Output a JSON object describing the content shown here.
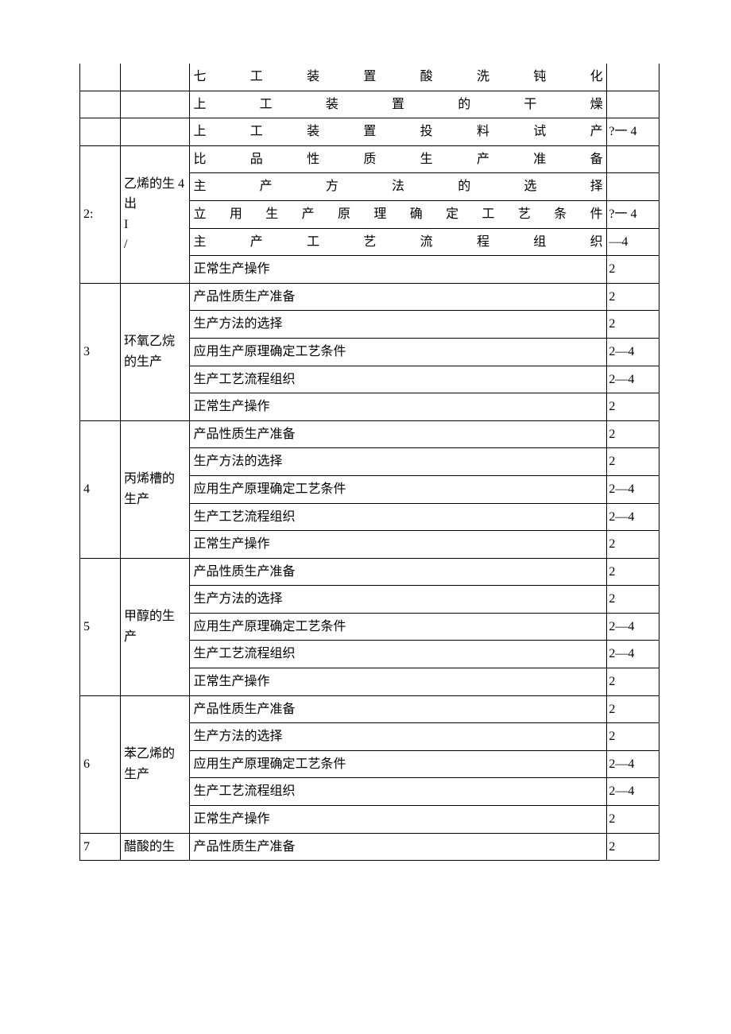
{
  "rows": [
    {
      "num": "",
      "name": "",
      "content": "七工装置酸洗钝化",
      "hours": "",
      "justify": true,
      "cellFlags": {
        "numNoTop": true,
        "nameNoTop": true,
        "contNoTop": true,
        "hoursNoTop": true
      },
      "spanNum": 1,
      "spanName": 1
    },
    {
      "num": "",
      "name": "",
      "content": "上工装置的干燥",
      "hours": "",
      "justify": true,
      "cellFlags": {
        "numNoTop": true,
        "nameNoTop": true
      },
      "spanNum": 1,
      "spanName": 1
    },
    {
      "num": "",
      "name": "",
      "content": "上工装置投料试产",
      "hours": "?一 4",
      "justify": true,
      "cellFlags": {
        "numNoTop": true,
        "nameNoTop": true
      },
      "spanNum": 1,
      "spanName": 1
    },
    {
      "num": "2:",
      "name": "乙烯的生 4\n出\nI\n/",
      "content": "比品性质生产准备",
      "hours": "",
      "justify": true,
      "spanNum": 5,
      "spanName": 5
    },
    {
      "content": "主产方法的选择",
      "hours": "",
      "justify": true
    },
    {
      "content": "立用生产原理确定工艺条件",
      "hours": "?一 4",
      "justify": true
    },
    {
      "content": "主产工艺流程组织",
      "hours": "—4",
      "justify": true
    },
    {
      "content": "正常生产操作",
      "hours": "2",
      "justify": false
    },
    {
      "num": "3",
      "name": "环氧乙烷的生产",
      "content": "产品性质生产准备",
      "hours": "2",
      "justify": false,
      "spanNum": 5,
      "spanName": 5
    },
    {
      "content": "生产方法的选择",
      "hours": "2",
      "justify": false
    },
    {
      "content": "应用生产原理确定工艺条件",
      "hours": "2—4",
      "justify": false
    },
    {
      "content": "生产工艺流程组织",
      "hours": "2—4",
      "justify": false
    },
    {
      "content": "正常生产操作",
      "hours": "2",
      "justify": false
    },
    {
      "num": "4",
      "name": "丙烯槽的生产",
      "content": "产品性质生产准备",
      "hours": "2",
      "justify": false,
      "spanNum": 5,
      "spanName": 5
    },
    {
      "content": "生产方法的选择",
      "hours": "2",
      "justify": false
    },
    {
      "content": "应用生产原理确定工艺条件",
      "hours": "2—4",
      "justify": false
    },
    {
      "content": "生产工艺流程组织",
      "hours": "2—4",
      "justify": false
    },
    {
      "content": "正常生产操作",
      "hours": "2",
      "justify": false
    },
    {
      "num": "5",
      "name": "甲醇的生产",
      "content": "产品性质生产准备",
      "hours": "2",
      "justify": false,
      "spanNum": 5,
      "spanName": 5
    },
    {
      "content": "生产方法的选择",
      "hours": "2",
      "justify": false
    },
    {
      "content": "应用生产原理确定工艺条件",
      "hours": "2—4",
      "justify": false
    },
    {
      "content": "生产工艺流程组织",
      "hours": "2—4",
      "justify": false
    },
    {
      "content": "正常生产操作",
      "hours": "2",
      "justify": false
    },
    {
      "num": "6",
      "name": "苯乙烯的生产",
      "content": "产品性质生产准备",
      "hours": "2",
      "justify": false,
      "spanNum": 5,
      "spanName": 5
    },
    {
      "content": "生产方法的选择",
      "hours": "2",
      "justify": false
    },
    {
      "content": "应用生产原理确定工艺条件",
      "hours": "2—4",
      "justify": false
    },
    {
      "content": "生产工艺流程组织",
      "hours": "2—4",
      "justify": false
    },
    {
      "content": "正常生产操作",
      "hours": "2",
      "justify": false
    },
    {
      "num": "7",
      "name": "醋酸的生",
      "content": "产品性质生产准备",
      "hours": "2",
      "justify": false,
      "spanNum": 1,
      "spanName": 1
    }
  ]
}
